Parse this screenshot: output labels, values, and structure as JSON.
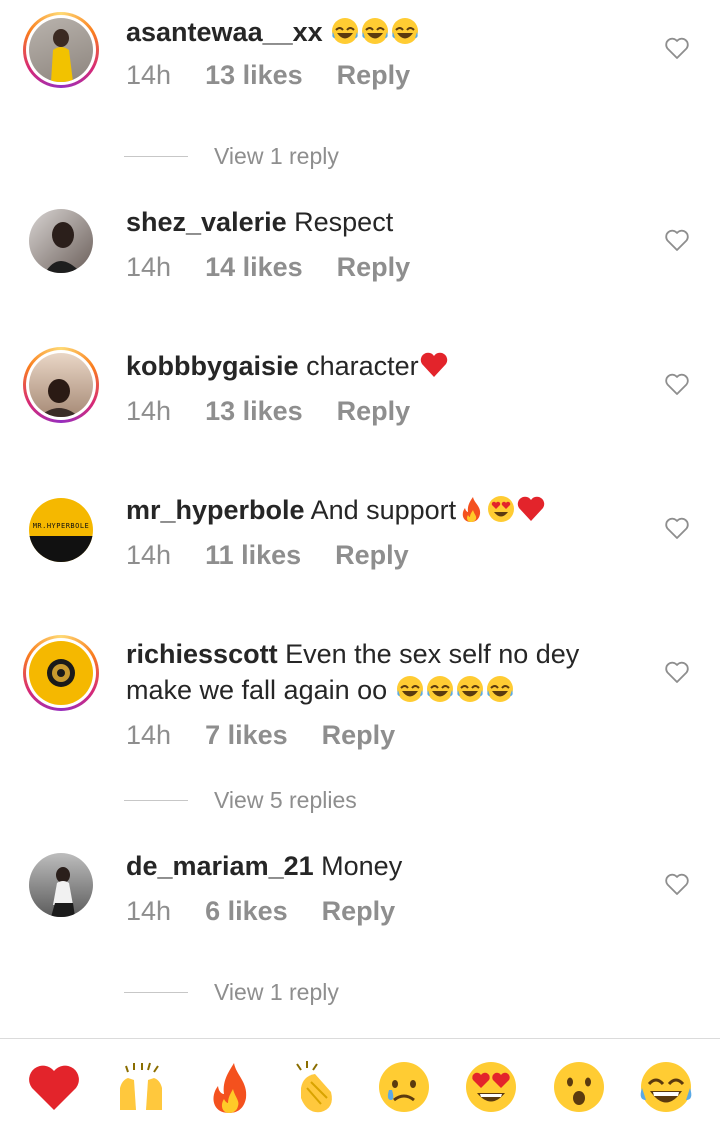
{
  "comments": [
    {
      "username": "asantewaa__xx",
      "text": "",
      "emojis": [
        "😂",
        "😂",
        "😂"
      ],
      "time": "14h",
      "likes": "13 likes",
      "reply": "Reply",
      "view_replies": "View 1 reply"
    },
    {
      "username": "shez_valerie",
      "text": "Respect",
      "emojis": [],
      "time": "14h",
      "likes": "14 likes",
      "reply": "Reply",
      "view_replies": ""
    },
    {
      "username": "kobbbygaisie",
      "text": "character",
      "emojis": [
        "❤️"
      ],
      "time": "14h",
      "likes": "13 likes",
      "reply": "Reply",
      "view_replies": ""
    },
    {
      "username": "mr_hyperbole",
      "text": "And support",
      "emojis": [
        "🔥",
        "😍",
        "❤️"
      ],
      "time": "14h",
      "likes": "11 likes",
      "reply": "Reply",
      "view_replies": ""
    },
    {
      "username": "richiesscott",
      "text": "Even the sex self no dey make we fall again oo",
      "emojis": [
        "😂",
        "😂",
        "😂",
        "😂"
      ],
      "time": "14h",
      "likes": "7 likes",
      "reply": "Reply",
      "view_replies": "View 5 replies"
    },
    {
      "username": "de_mariam_21",
      "text": "Money",
      "emojis": [],
      "time": "14h",
      "likes": "6 likes",
      "reply": "Reply",
      "view_replies": "View 1 reply"
    }
  ],
  "avatar_text": {
    "mr_hyperbole": "MR.HYPERBOLE"
  },
  "quick_reactions": [
    "heart",
    "raised-hands",
    "fire",
    "clapping-hands",
    "crying-face",
    "heart-eyes",
    "surprised-face",
    "tears-of-joy"
  ],
  "colors": {
    "text": "#262626",
    "muted": "#8e8e8e",
    "heart_red": "#e0245e"
  }
}
